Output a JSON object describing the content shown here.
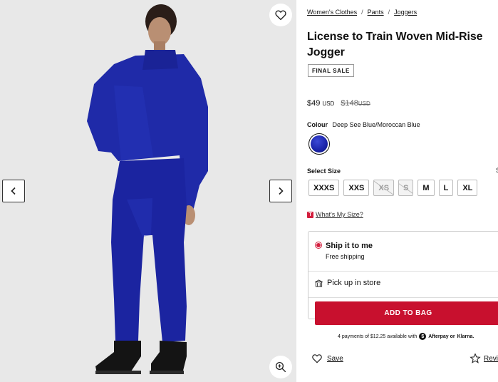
{
  "gallery": {
    "favorite_icon": "heart-outline-icon",
    "prev_icon": "chevron-left-icon",
    "next_icon": "chevron-right-icon",
    "zoom_icon": "zoom-in-icon"
  },
  "breadcrumb": [
    "Women's Clothes",
    "Pants",
    "Joggers"
  ],
  "breadcrumb_separator": "/",
  "product": {
    "title": "License to Train Woven Mid-Rise Jogger",
    "final_sale": "FINAL SALE",
    "price": "$49",
    "price_currency": "USD",
    "original_price": "$148",
    "original_currency": "USD"
  },
  "colour": {
    "label": "Colour",
    "value": "Deep See Blue/Moroccan Blue",
    "swatch_color": "#1f2aa8"
  },
  "sizes": {
    "label": "Select Size",
    "guide_stub": "S",
    "options": [
      {
        "label": "XXXS",
        "available": true
      },
      {
        "label": "XXS",
        "available": true
      },
      {
        "label": "XS",
        "available": false
      },
      {
        "label": "S",
        "available": false
      },
      {
        "label": "M",
        "available": true
      },
      {
        "label": "L",
        "available": true
      },
      {
        "label": "XL",
        "available": true
      }
    ],
    "whats_my_size_badge": "T",
    "whats_my_size": "What's My Size?"
  },
  "fulfillment": {
    "ship_title": "Ship it to me",
    "ship_sub": "Free shipping",
    "pickup": "Pick up in store",
    "add_to_bag": "ADD TO BAG"
  },
  "installments": {
    "text": "4 payments of $12.25 available with",
    "afterpay_badge": "$",
    "afterpay": "Afterpay or",
    "klarna": "Klarna."
  },
  "actions": {
    "save": "Save",
    "review": "Revi"
  },
  "colors": {
    "accent_red": "#c8102e",
    "jacket_blue": "#1f2aa8"
  }
}
